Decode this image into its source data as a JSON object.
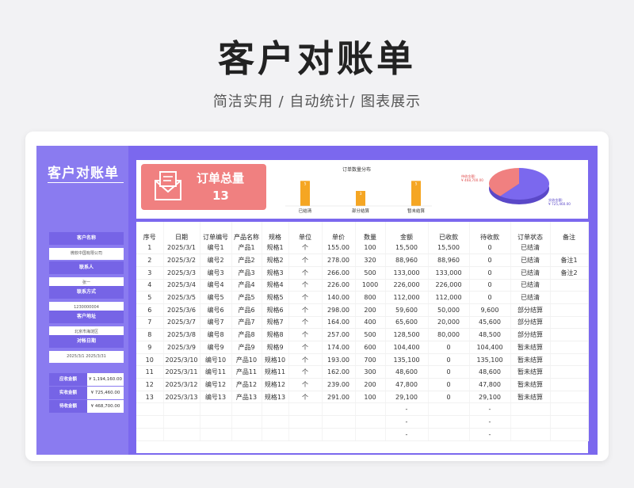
{
  "header": {
    "title": "客户对账单",
    "subtitle": "简洁实用 / 自动统计/ 图表展示"
  },
  "left_panel": {
    "title": "客户对账单",
    "fields": [
      {
        "label": "客户名称",
        "value": "微软中国有限公司"
      },
      {
        "label": "联系人",
        "value": "张一"
      },
      {
        "label": "联系方式",
        "value": "1230000004"
      },
      {
        "label": "客户地址",
        "value": "北京市海淀区"
      },
      {
        "label": "对帐日期",
        "value": "2025/3/1   2025/3/31"
      }
    ],
    "amounts": [
      {
        "label": "应收金额",
        "value": "¥ 1,194,160.00"
      },
      {
        "label": "实收金额",
        "value": "¥ 725,460.00"
      },
      {
        "label": "待收金额",
        "value": "¥ 468,700.00"
      }
    ]
  },
  "dashboard": {
    "total_label": "订单总量",
    "total_value": "13",
    "icon": "envelope-icon",
    "colors": {
      "total_bg": "#f08080",
      "bar": "#f5a623",
      "accent": "#7b68ee"
    }
  },
  "chart_data": [
    {
      "type": "bar",
      "title": "订单数量分布",
      "categories": [
        "已结清",
        "部分结算",
        "暂未结算"
      ],
      "values": [
        5,
        3,
        5
      ],
      "ylim": [
        0,
        6
      ]
    },
    {
      "type": "pie",
      "labels": [
        "待收金额:",
        "实收金额:"
      ],
      "label_values": [
        "¥ 468,700.00",
        "¥ 725,460.00"
      ],
      "values": [
        468700,
        725460
      ],
      "colors": [
        "#f08080",
        "#7b68ee"
      ]
    }
  ],
  "table": {
    "headers": [
      "序号",
      "日期",
      "订单编号",
      "产品名称",
      "规格",
      "单位",
      "单价",
      "数量",
      "金额",
      "已收款",
      "待收款",
      "订单状态",
      "备注"
    ],
    "rows": [
      [
        "1",
        "2025/3/1",
        "编号1",
        "产品1",
        "规格1",
        "个",
        "155.00",
        "100",
        "15,500",
        "15,500",
        "0",
        "已结清",
        ""
      ],
      [
        "2",
        "2025/3/2",
        "编号2",
        "产品2",
        "规格2",
        "个",
        "278.00",
        "320",
        "88,960",
        "88,960",
        "0",
        "已结清",
        "备注1"
      ],
      [
        "3",
        "2025/3/3",
        "编号3",
        "产品3",
        "规格3",
        "个",
        "266.00",
        "500",
        "133,000",
        "133,000",
        "0",
        "已结清",
        "备注2"
      ],
      [
        "4",
        "2025/3/4",
        "编号4",
        "产品4",
        "规格4",
        "个",
        "226.00",
        "1000",
        "226,000",
        "226,000",
        "0",
        "已结清",
        ""
      ],
      [
        "5",
        "2025/3/5",
        "编号5",
        "产品5",
        "规格5",
        "个",
        "140.00",
        "800",
        "112,000",
        "112,000",
        "0",
        "已结清",
        ""
      ],
      [
        "6",
        "2025/3/6",
        "编号6",
        "产品6",
        "规格6",
        "个",
        "298.00",
        "200",
        "59,600",
        "50,000",
        "9,600",
        "部分结算",
        ""
      ],
      [
        "7",
        "2025/3/7",
        "编号7",
        "产品7",
        "规格7",
        "个",
        "164.00",
        "400",
        "65,600",
        "20,000",
        "45,600",
        "部分结算",
        ""
      ],
      [
        "8",
        "2025/3/8",
        "编号8",
        "产品8",
        "规格8",
        "个",
        "257.00",
        "500",
        "128,500",
        "80,000",
        "48,500",
        "部分结算",
        ""
      ],
      [
        "9",
        "2025/3/9",
        "编号9",
        "产品9",
        "规格9",
        "个",
        "174.00",
        "600",
        "104,400",
        "0",
        "104,400",
        "暂未结算",
        ""
      ],
      [
        "10",
        "2025/3/10",
        "编号10",
        "产品10",
        "规格10",
        "个",
        "193.00",
        "700",
        "135,100",
        "0",
        "135,100",
        "暂未结算",
        ""
      ],
      [
        "11",
        "2025/3/11",
        "编号11",
        "产品11",
        "规格11",
        "个",
        "162.00",
        "300",
        "48,600",
        "0",
        "48,600",
        "暂未结算",
        ""
      ],
      [
        "12",
        "2025/3/12",
        "编号12",
        "产品12",
        "规格12",
        "个",
        "239.00",
        "200",
        "47,800",
        "0",
        "47,800",
        "暂未结算",
        ""
      ],
      [
        "13",
        "2025/3/13",
        "编号13",
        "产品13",
        "规格13",
        "个",
        "291.00",
        "100",
        "29,100",
        "0",
        "29,100",
        "暂未结算",
        ""
      ],
      [
        "",
        "",
        "",
        "",
        "",
        "",
        "",
        "",
        "-",
        "",
        "-",
        "",
        ""
      ],
      [
        "",
        "",
        "",
        "",
        "",
        "",
        "",
        "",
        "-",
        "",
        "-",
        "",
        ""
      ],
      [
        "",
        "",
        "",
        "",
        "",
        "",
        "",
        "",
        "-",
        "",
        "-",
        "",
        ""
      ]
    ]
  }
}
